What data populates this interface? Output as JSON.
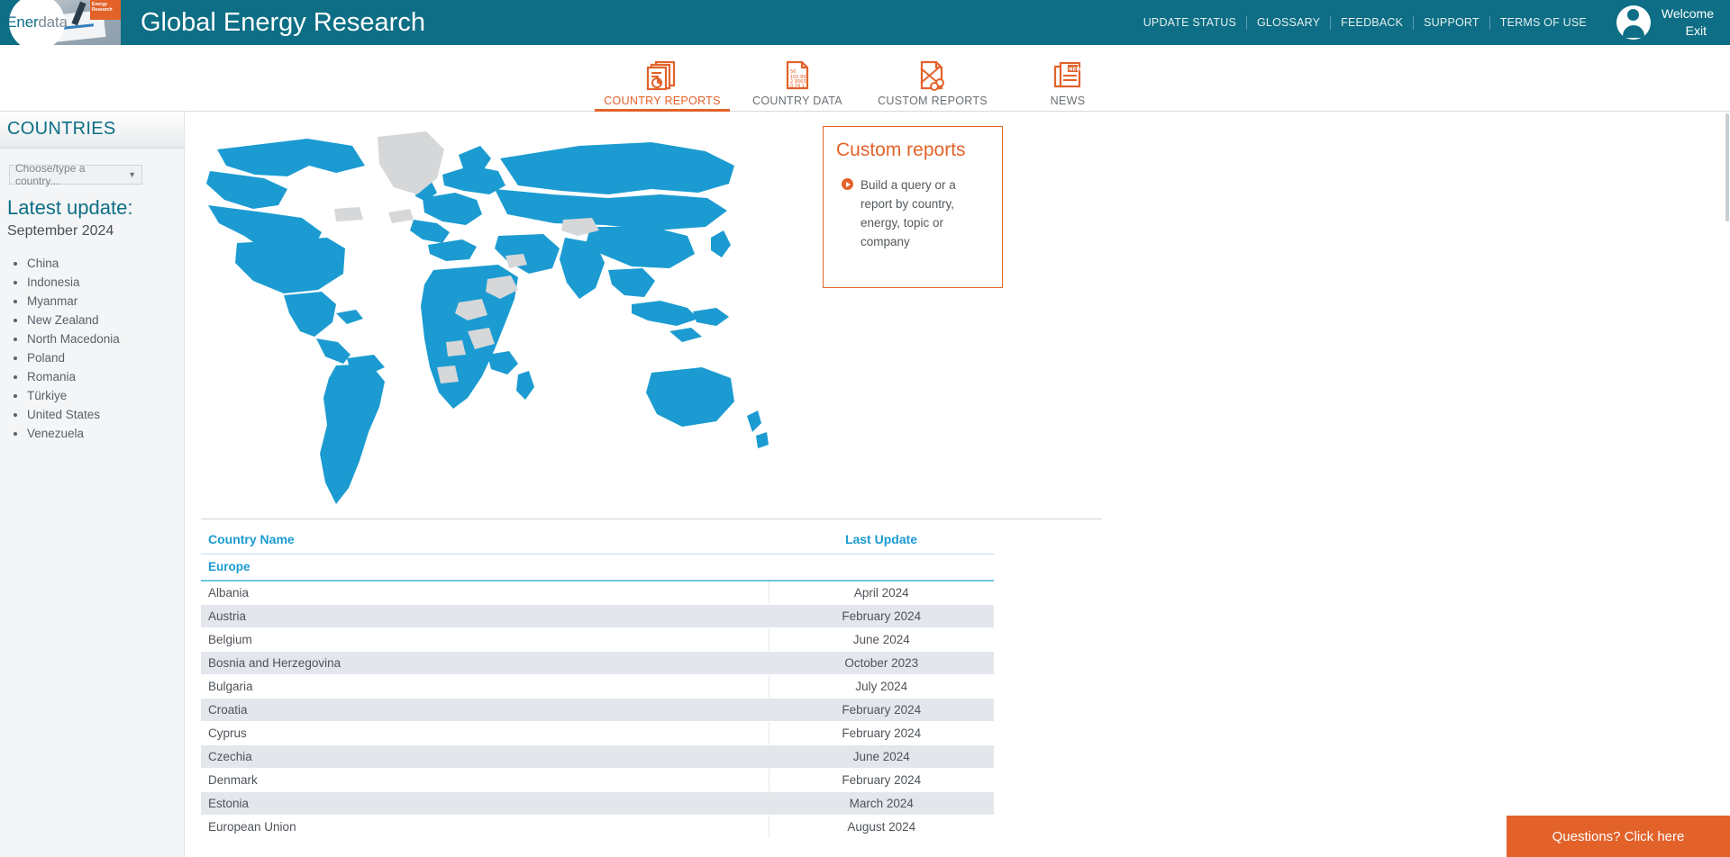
{
  "header": {
    "logo_text_bold": "Ener",
    "logo_text_light": "data",
    "site_title": "Global Energy Research",
    "top_links": [
      {
        "label": "UPDATE STATUS",
        "name": "update-status"
      },
      {
        "label": "GLOSSARY",
        "name": "glossary"
      },
      {
        "label": "FEEDBACK",
        "name": "feedback"
      },
      {
        "label": "SUPPORT",
        "name": "support"
      },
      {
        "label": "TERMS OF USE",
        "name": "terms-of-use"
      }
    ],
    "welcome": "Welcome",
    "exit": "Exit",
    "avatar_icon": "user-avatar-icon",
    "bg_color": "#0d6e85"
  },
  "nav": {
    "tabs": [
      {
        "label": "COUNTRY REPORTS",
        "icon": "documents-report-icon",
        "active": true
      },
      {
        "label": "COUNTRY DATA",
        "icon": "data-sheet-icon",
        "active": false
      },
      {
        "label": "CUSTOM REPORTS",
        "icon": "scissors-document-icon",
        "active": false
      },
      {
        "label": "NEWS",
        "icon": "newspaper-icon",
        "active": false
      }
    ],
    "accent_color": "#e2622a"
  },
  "sidebar": {
    "title": "COUNTRIES",
    "country_select_placeholder": "Choose/type a country...",
    "caret_icon": "chevron-down-icon",
    "latest_update_label": "Latest update:",
    "latest_update_date": "September 2024",
    "countries": [
      "China",
      "Indonesia",
      "Myanmar",
      "New Zealand",
      "North Macedonia",
      "Poland",
      "Romania",
      "Türkiye",
      "United States",
      "Venezuela"
    ]
  },
  "main": {
    "map": {
      "name": "world-map",
      "highlight_color": "#1b9bd1",
      "inactive_color": "#d5d7d9"
    },
    "custom_reports_box": {
      "title": "Custom reports",
      "bullet_icon": "play-circle-icon",
      "text": "Build a query or a report by country, energy, topic or company",
      "border_color": "#e2622a"
    },
    "table": {
      "columns": [
        "Country Name",
        "Last Update"
      ],
      "group": "Europe",
      "rows": [
        {
          "country": "Albania",
          "update": "April 2024"
        },
        {
          "country": "Austria",
          "update": "February 2024"
        },
        {
          "country": "Belgium",
          "update": "June 2024"
        },
        {
          "country": "Bosnia and Herzegovina",
          "update": "October 2023"
        },
        {
          "country": "Bulgaria",
          "update": "July 2024"
        },
        {
          "country": "Croatia",
          "update": "February 2024"
        },
        {
          "country": "Cyprus",
          "update": "February 2024"
        },
        {
          "country": "Czechia",
          "update": "June 2024"
        },
        {
          "country": "Denmark",
          "update": "February 2024"
        },
        {
          "country": "Estonia",
          "update": "March 2024"
        },
        {
          "country": "European Union",
          "update": "August 2024"
        }
      ]
    }
  },
  "help_button": {
    "label": "Questions? Click here",
    "color": "#e2622a"
  }
}
